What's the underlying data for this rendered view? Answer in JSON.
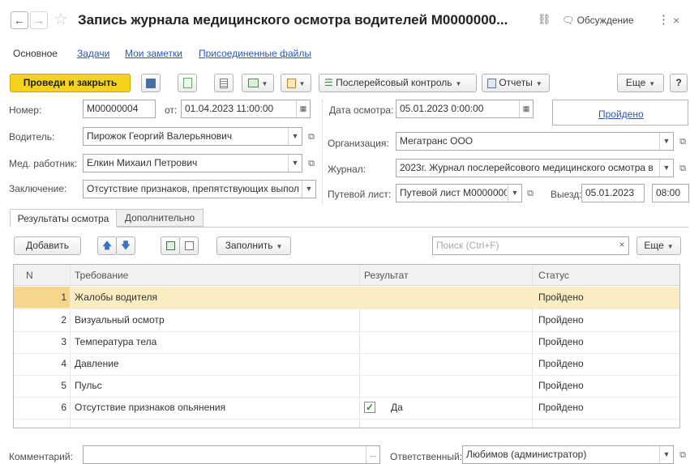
{
  "window": {
    "title": "Запись журнала медицинского осмотра водителей М0000000...",
    "discussion": "Обсуждение"
  },
  "nav_tabs": [
    "Основное",
    "Задачи",
    "Мои заметки",
    "Присоединенные файлы"
  ],
  "toolbar": {
    "post_close": "Проведи и закрыть",
    "post_trip_control": "Послерейсовый контроль",
    "reports": "Отчеты",
    "more": "Еще",
    "help": "?"
  },
  "form": {
    "number_label": "Номер:",
    "number_value": "М00000004",
    "from_label": "от:",
    "from_value": "01.04.2023 11:00:00",
    "exam_date_label": "Дата осмотра:",
    "exam_date_value": "05.01.2023  0:00:00",
    "status_link": "Пройдено",
    "driver_label": "Водитель:",
    "driver_value": "Пирожок Георгий Валерьянович",
    "org_label": "Организация:",
    "org_value": "Мегатранс ООО",
    "medic_label": "Мед. работник:",
    "medic_value": "Елкин Михаил Петрович",
    "journal_label": "Журнал:",
    "journal_value": "2023г. Журнал послерейсового медицинского осмотра в",
    "conclusion_label": "Заключение:",
    "conclusion_value": "Отсутствие признаков, препятствующих выполн",
    "waybill_label": "Путевой лист:",
    "waybill_value": "Путевой лист М0000000",
    "departure_label": "Выезд:",
    "departure_date": "05.01.2023",
    "departure_time": "08:00"
  },
  "inner_tabs": [
    "Результаты осмотра",
    "Дополнительно"
  ],
  "table_toolbar": {
    "add": "Добавить",
    "fill": "Заполнить",
    "search_placeholder": "Поиск (Ctrl+F)",
    "search_clear": "×",
    "more": "Еще"
  },
  "table": {
    "columns": [
      "N",
      "Требование",
      "Результат",
      "Статус"
    ],
    "rows": [
      {
        "n": "1",
        "requirement": "Жалобы водителя",
        "result": "",
        "status": "Пройдено"
      },
      {
        "n": "2",
        "requirement": "Визуальный осмотр",
        "result": "",
        "status": "Пройдено"
      },
      {
        "n": "3",
        "requirement": "Температура тела",
        "result": "",
        "status": "Пройдено"
      },
      {
        "n": "4",
        "requirement": "Давление",
        "result": "",
        "status": "Пройдено"
      },
      {
        "n": "5",
        "requirement": "Пульс",
        "result": "",
        "status": "Пройдено"
      },
      {
        "n": "6",
        "requirement": "Отсутствие признаков опьянения",
        "result": "Да",
        "status": "Пройдено"
      }
    ]
  },
  "footer": {
    "comment_label": "Комментарий:",
    "comment_value": "",
    "responsible_label": "Ответственный:",
    "responsible_value": "Любимов (администратор)"
  },
  "colors": {
    "accent_yellow": "#f5d21c",
    "selected_row": "#fbedc2",
    "selected_cell": "#f6d68a",
    "link": "#2d58a8",
    "check_green": "#2e8b2e"
  }
}
